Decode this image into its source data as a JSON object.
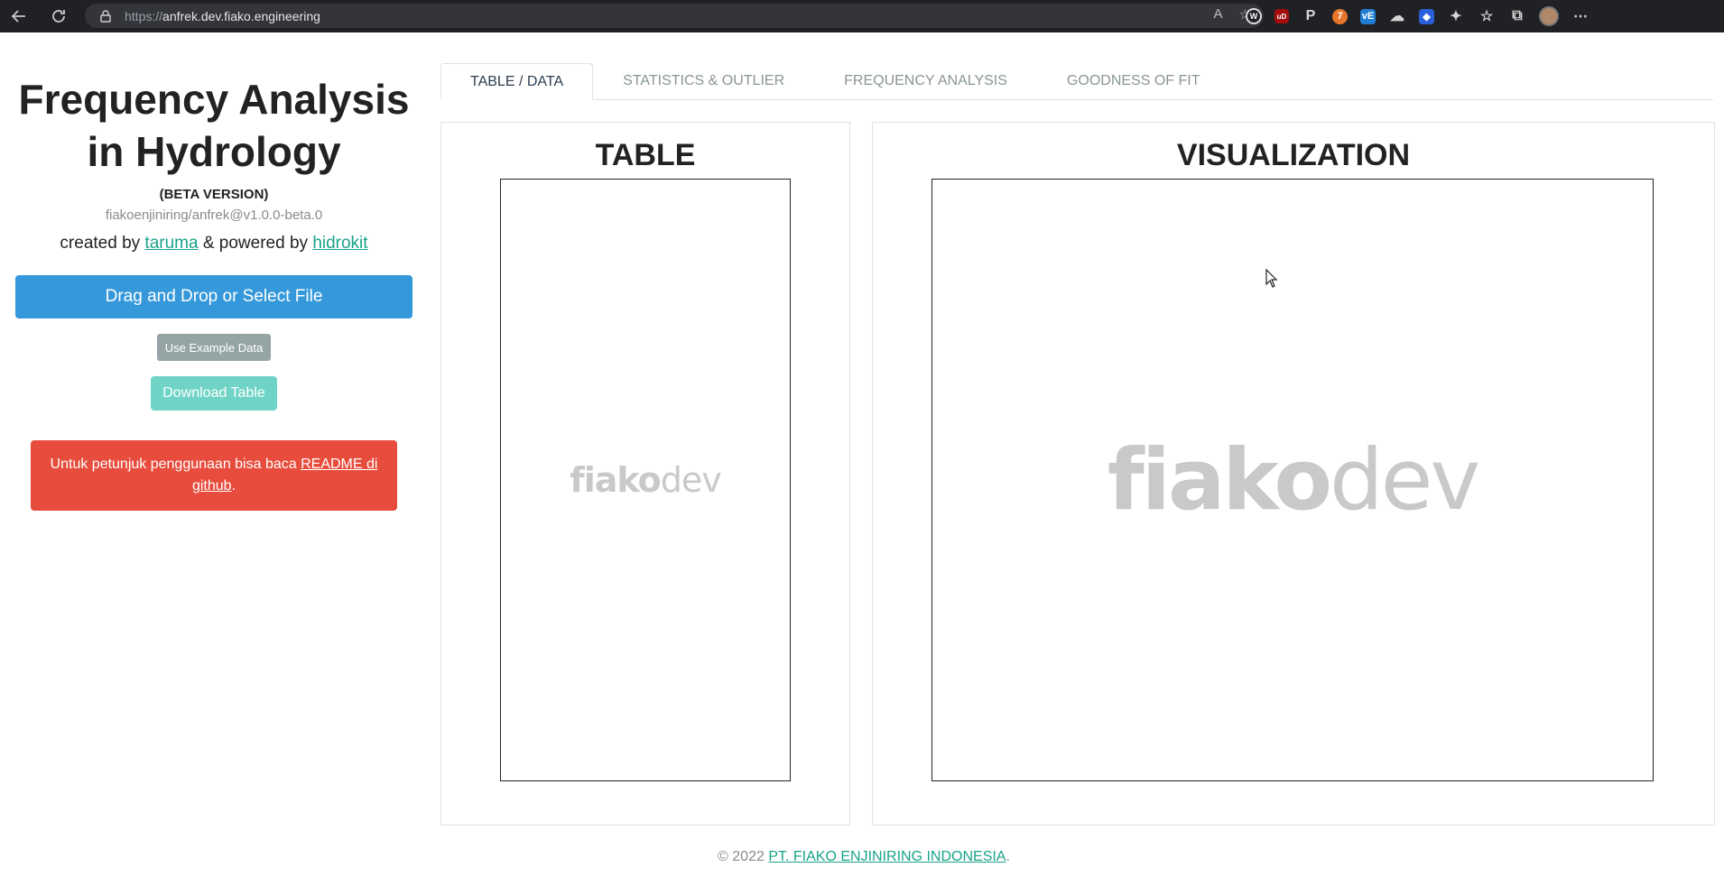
{
  "browser": {
    "url_scheme": "https://",
    "url_host": "anfrek.dev.fiako.engineering",
    "read_aloud_icon_label": "A",
    "extensions": [
      {
        "name": "W",
        "color": "#202124"
      },
      {
        "name": "uD",
        "color": "#a40d0d"
      },
      {
        "name": "P",
        "color": "#202124"
      },
      {
        "name": "7",
        "color": "#e8752a"
      },
      {
        "name": "vE",
        "color": "#1f7ed4"
      }
    ]
  },
  "sidebar": {
    "title": "Frequency Analysis in Hydrology",
    "beta": "(BETA VERSION)",
    "version": "fiakoenjiniring/anfrek@v1.0.0-beta.0",
    "created_by_prefix": "created by ",
    "author_link": "taruma",
    "powered_by_text": " & powered by ",
    "powered_link": "hidrokit",
    "upload_label": "Drag and Drop or Select File",
    "example_label": "Use Example Data",
    "download_label": "Download Table",
    "alert_text": "Untuk petunjuk penggunaan bisa baca ",
    "alert_link": "README di github",
    "alert_end": "."
  },
  "tabs": [
    {
      "label": "TABLE / DATA",
      "active": true
    },
    {
      "label": "STATISTICS & OUTLIER",
      "active": false
    },
    {
      "label": "FREQUENCY ANALYSIS",
      "active": false
    },
    {
      "label": "GOODNESS OF FIT",
      "active": false
    }
  ],
  "panels": {
    "table_title": "TABLE",
    "viz_title": "VISUALIZATION",
    "watermark_strong": "fiako",
    "watermark_light": "dev"
  },
  "footer": {
    "prefix": "© 2022 ",
    "link": "PT. FIAKO ENJINIRING INDONESIA",
    "suffix": "."
  },
  "colors": {
    "primary": "#3498db",
    "secondary": "#95a5a6",
    "info": "#6fd3c5",
    "danger": "#e74c3c",
    "link": "#18a38a"
  }
}
